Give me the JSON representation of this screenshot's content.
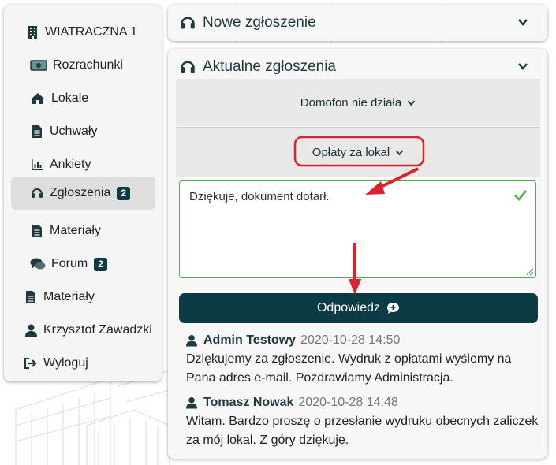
{
  "sidebar": {
    "items": [
      {
        "label": "WIATRACZNA 1",
        "icon": "building-icon"
      },
      {
        "label": "Rozrachunki",
        "icon": "money-icon"
      },
      {
        "label": "Lokale",
        "icon": "home-icon"
      },
      {
        "label": "Uchwały",
        "icon": "document-icon"
      },
      {
        "label": "Ankiety",
        "icon": "bar-chart-icon"
      },
      {
        "label": "Zgłoszenia",
        "icon": "headset-icon",
        "badge": "2",
        "active": true
      },
      {
        "label": "Materiały",
        "icon": "document-icon"
      },
      {
        "label": "Forum",
        "icon": "chat-icon",
        "badge": "2"
      },
      {
        "label": "Materiały",
        "icon": "document-icon"
      },
      {
        "label": "Krzysztof Zawadzki",
        "icon": "user-icon"
      },
      {
        "label": "Wyloguj",
        "icon": "logout-icon"
      }
    ]
  },
  "new_ticket": {
    "title": "Nowe zgłoszenie"
  },
  "current_tickets": {
    "title": "Aktualne zgłoszenia",
    "tickets": [
      {
        "title": "Domofon nie działa"
      },
      {
        "title": "Opłaty za lokal"
      }
    ],
    "reply_text": "Dziękuje, dokument dotarł.",
    "send_label": "Odpowiedz",
    "messages": [
      {
        "author": "Admin Testowy",
        "date": "2020-10-28 14:50",
        "text": "Dziękujemy za zgłoszenie. Wydruk z opłatami wyślemy na Pana adres e-mail. Pozdrawiamy Administracja."
      },
      {
        "author": "Tomasz Nowak",
        "date": "2020-10-28 14:48",
        "text": "Witam. Bardzo proszę o przesłanie wydruku obecnych zaliczek za mój lokal. Z góry dziękuje."
      }
    ]
  },
  "colors": {
    "accent": "#0d3b45",
    "success": "#4cae4c",
    "annotation": "#d9232d"
  }
}
